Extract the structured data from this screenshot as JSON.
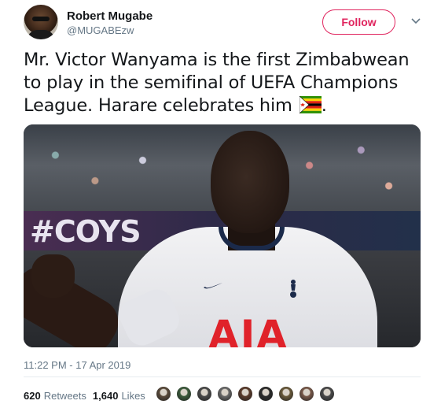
{
  "tweet": {
    "author": {
      "display_name": "Robert Mugabe",
      "handle": "@MUGABEzw",
      "avatar_icon": "profile-photo"
    },
    "follow_label": "Follow",
    "text": "Mr. Victor Wanyama is the first Zimbabwean to play in the semifinal of UEFA Champions League. Harare celebrates him",
    "text_suffix": ".",
    "flag_icon": "zimbabwe-flag-emoji",
    "media": {
      "stadium_banner_text": "#COYS",
      "sponsor_text": "AIA"
    },
    "timestamp": "11:22 PM - 17 Apr 2019",
    "stats": {
      "retweets_count": "620",
      "retweets_label": "Retweets",
      "likes_count": "1,640",
      "likes_label": "Likes"
    },
    "likers": [
      "#5a4a3a",
      "#3a5a3a",
      "#4a4a4a",
      "#6a6a6a",
      "#5a3a2a",
      "#2a2a2a",
      "#6a5a3a",
      "#7a5a4a",
      "#4a4a4a"
    ]
  },
  "colors": {
    "accent": "#e0245e",
    "secondary_text": "#657786",
    "primary_text": "#14171a"
  }
}
